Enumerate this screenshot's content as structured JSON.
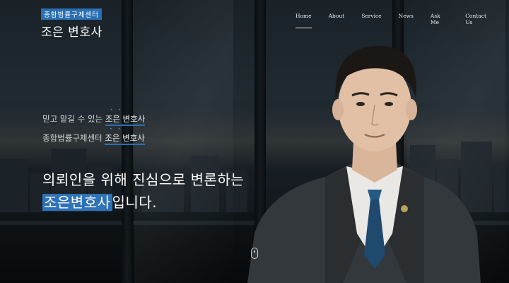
{
  "header": {
    "logo_sub": "종합법률구제센터",
    "logo_main": "조은 변호사"
  },
  "nav": {
    "items": [
      "Home",
      "About",
      "Service",
      "News",
      "Ask Me",
      "Contact Us"
    ],
    "active": "Home"
  },
  "hero": {
    "line1_prefix": "믿고 맡길 수 있는 ",
    "line1_highlight": "조은 변호사",
    "line2_prefix": "종합법률구제센터 ",
    "line2_highlight": "조은 변호사",
    "headline_line1": "의뢰인을 위해 진심으로 변론하는",
    "headline_highlight": "조은변호사",
    "headline_suffix": "입니다."
  },
  "colors": {
    "accent": "#2e72b8",
    "text": "#ffffff"
  },
  "icons": {
    "scroll": "mouse-scroll-icon"
  }
}
